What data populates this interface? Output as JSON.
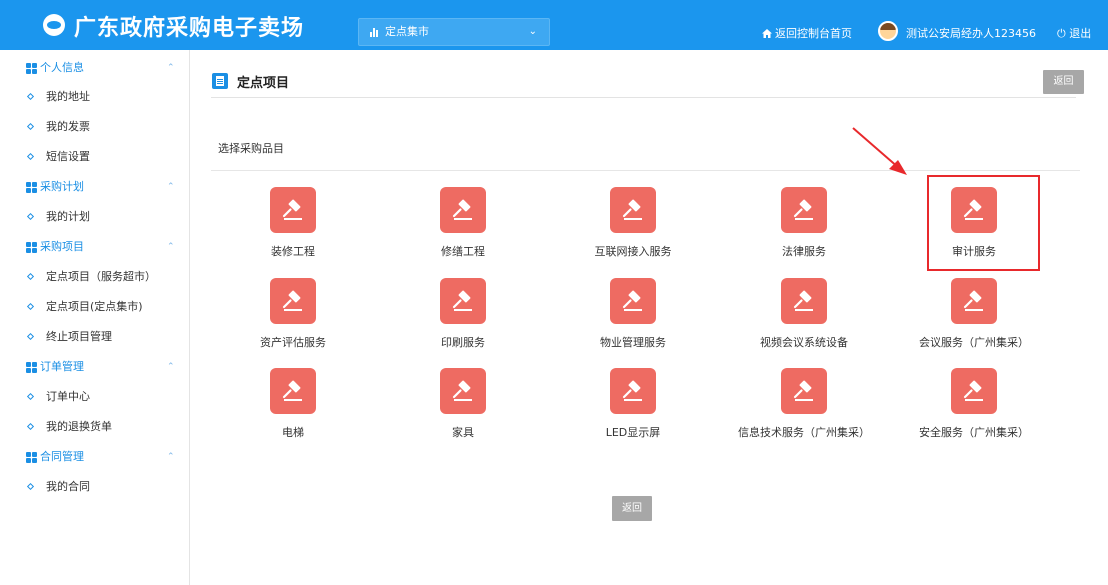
{
  "header": {
    "logo_text": "广东政府采购电子卖场",
    "market_select_value": "定点集市",
    "home_link": "返回控制台首页",
    "user_name": "测试公安局经办人123456",
    "logout": "退出"
  },
  "sidebar": {
    "groups": [
      {
        "label": "个人信息",
        "items": [
          "我的地址",
          "我的发票",
          "短信设置"
        ]
      },
      {
        "label": "采购计划",
        "items": [
          "我的计划"
        ]
      },
      {
        "label": "采购项目",
        "items": [
          "定点项目（服务超市）",
          "定点项目(定点集市)",
          "终止项目管理"
        ]
      },
      {
        "label": "订单管理",
        "items": [
          "订单中心",
          "我的退换货单"
        ]
      },
      {
        "label": "合同管理",
        "items": [
          "我的合同"
        ]
      }
    ]
  },
  "main": {
    "page_title": "定点项目",
    "return_button": "返回",
    "section_label": "选择采购品目",
    "categories": [
      "装修工程",
      "修缮工程",
      "互联网接入服务",
      "法律服务",
      "审计服务",
      "资产评估服务",
      "印刷服务",
      "物业管理服务",
      "视频会议系统设备",
      "会议服务（广州集采）",
      "电梯",
      "家具",
      "LED显示屏",
      "信息技术服务（广州集采）",
      "安全服务（广州集采）"
    ],
    "bottom_return_button": "返回"
  },
  "colors": {
    "primary": "#1b96ee",
    "tile": "#ee6b62",
    "highlight": "#e8292c",
    "button_gray": "#a7a7a7"
  },
  "icons": {
    "category_tile": "gavel-icon",
    "page": "document-icon",
    "group": "grid-icon",
    "item": "diamond-icon"
  }
}
